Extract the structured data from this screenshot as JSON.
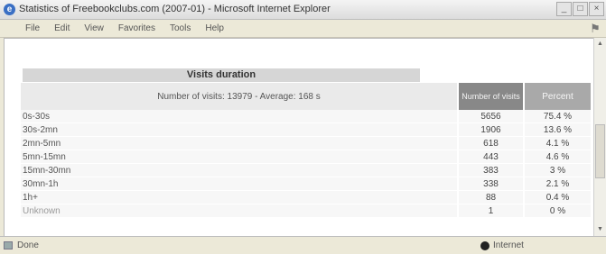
{
  "window": {
    "title": "Statistics of Freebookclubs.com (2007-01) - Microsoft Internet Explorer",
    "controls": [
      "_",
      "□",
      "×"
    ]
  },
  "menu": {
    "items": [
      "File",
      "Edit",
      "View",
      "Favorites",
      "Tools",
      "Help"
    ]
  },
  "section": {
    "title": "Visits duration",
    "summary": "Number of visits: 13979 - Average: 168 s",
    "col_visits": "Number of visits",
    "col_percent": "Percent"
  },
  "rows": [
    {
      "label": "0s-30s",
      "visits": "5656",
      "percent": "75.4 %"
    },
    {
      "label": "30s-2mn",
      "visits": "1906",
      "percent": "13.6 %"
    },
    {
      "label": "2mn-5mn",
      "visits": "618",
      "percent": "4.1 %"
    },
    {
      "label": "5mn-15mn",
      "visits": "443",
      "percent": "4.6 %"
    },
    {
      "label": "15mn-30mn",
      "visits": "383",
      "percent": "3 %"
    },
    {
      "label": "30mn-1h",
      "visits": "338",
      "percent": "2.1 %"
    },
    {
      "label": "1h+",
      "visits": "88",
      "percent": "0.4 %"
    },
    {
      "label": "Unknown",
      "visits": "1",
      "percent": "0 %"
    }
  ],
  "status": {
    "left": "Done",
    "zone": "Internet"
  }
}
